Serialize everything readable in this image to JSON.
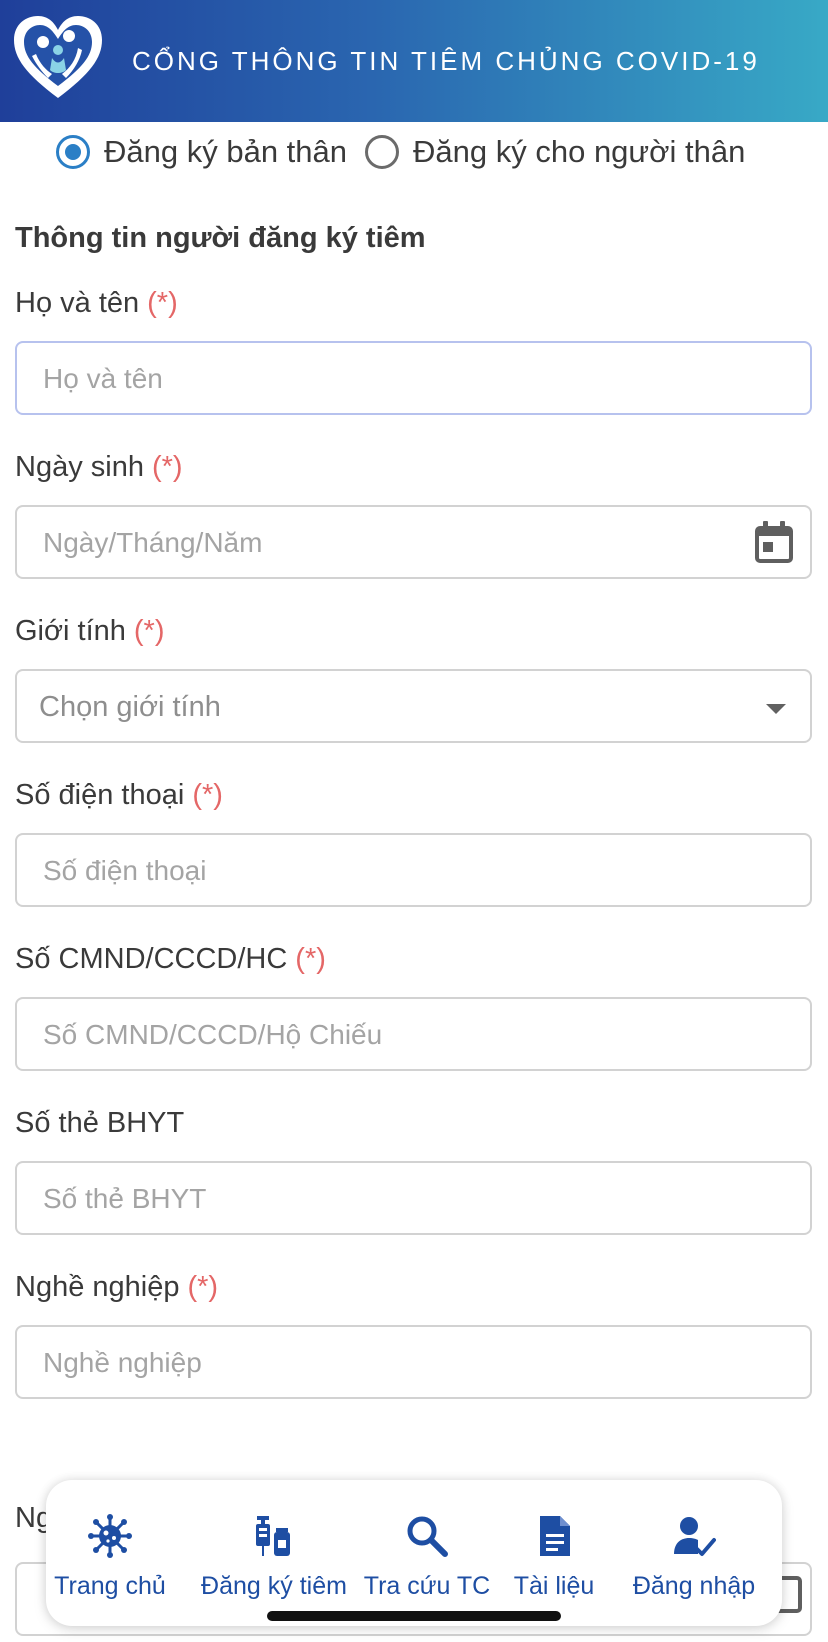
{
  "header": {
    "title": "CỔNG THÔNG TIN TIÊM CHỦNG COVID-19"
  },
  "register_mode": {
    "options": [
      {
        "label": "Đăng ký bản thân",
        "selected": true
      },
      {
        "label": "Đăng ký cho người thân",
        "selected": false
      }
    ]
  },
  "section_title": "Thông tin người đăng ký tiêm",
  "required_mark": "(*)",
  "form": {
    "full_name": {
      "label": "Họ và tên",
      "placeholder": "Họ và tên",
      "value": ""
    },
    "dob": {
      "label": "Ngày sinh",
      "placeholder": "Ngày/Tháng/Năm",
      "value": ""
    },
    "gender": {
      "label": "Giới tính",
      "selected": "Chọn giới tính"
    },
    "phone": {
      "label": "Số điện thoại",
      "placeholder": "Số điện thoại",
      "value": ""
    },
    "id_number": {
      "label": "Số CMND/CCCD/HC",
      "placeholder": "Số CMND/CCCD/Hộ Chiếu",
      "value": ""
    },
    "insurance": {
      "label": "Số thẻ BHYT",
      "placeholder": "Số thẻ BHYT",
      "value": ""
    },
    "occupation": {
      "label": "Nghề nghiệp",
      "placeholder": "Nghề nghiệp",
      "value": ""
    },
    "next_partial_label": "Ng"
  },
  "bottom_nav": {
    "items": [
      {
        "label": "Trang chủ",
        "icon": "virus-icon"
      },
      {
        "label": "Đăng ký tiêm",
        "icon": "vaccine-icon"
      },
      {
        "label": "Tra cứu TC",
        "icon": "search-icon"
      },
      {
        "label": "Tài liệu",
        "icon": "document-icon"
      },
      {
        "label": "Đăng nhập",
        "icon": "user-check-icon"
      }
    ]
  },
  "colors": {
    "header_start": "#1f3f9a",
    "header_end": "#38a9c6",
    "accent": "#2b7fc6",
    "required": "#e46767",
    "nav": "#1e4ea3"
  }
}
